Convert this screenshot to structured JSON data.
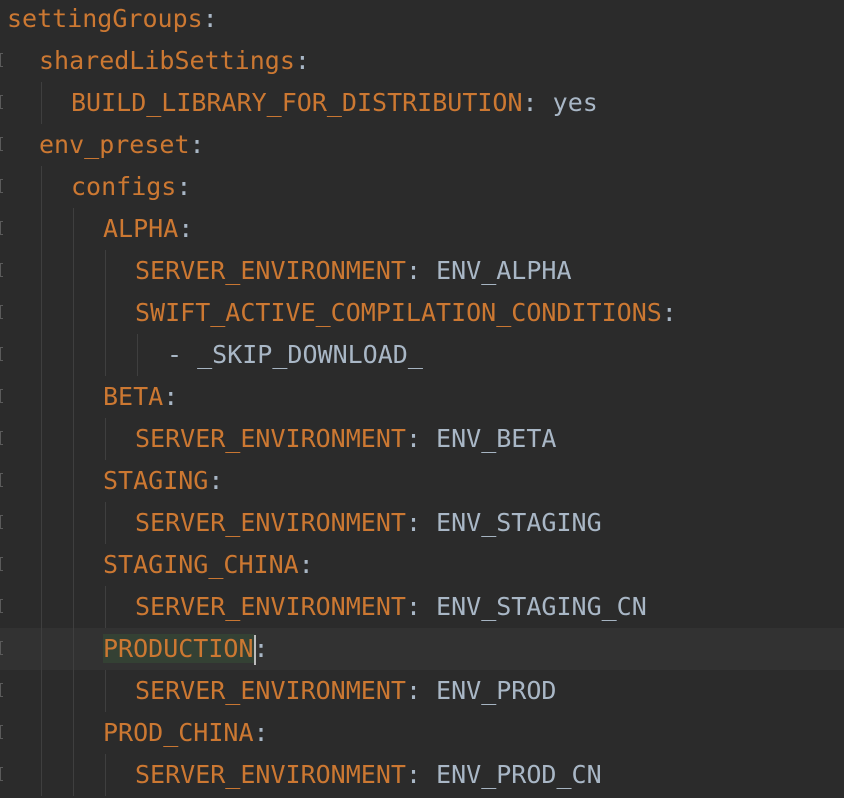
{
  "editor": {
    "lines": [
      {
        "indent": 0,
        "key": "settingGroups",
        "sep": ":",
        "value": ""
      },
      {
        "indent": 1,
        "key": "sharedLibSettings",
        "sep": ":",
        "value": ""
      },
      {
        "indent": 2,
        "key": "BUILD_LIBRARY_FOR_DISTRIBUTION",
        "sep": ":",
        "value": " yes"
      },
      {
        "indent": 1,
        "key": "env_preset",
        "sep": ":",
        "value": ""
      },
      {
        "indent": 2,
        "key": "configs",
        "sep": ":",
        "value": ""
      },
      {
        "indent": 3,
        "key": "ALPHA",
        "sep": ":",
        "value": ""
      },
      {
        "indent": 4,
        "key": "SERVER_ENVIRONMENT",
        "sep": ":",
        "value": " ENV_ALPHA"
      },
      {
        "indent": 4,
        "key": "SWIFT_ACTIVE_COMPILATION_CONDITIONS",
        "sep": ":",
        "value": ""
      },
      {
        "indent": 5,
        "key": "",
        "sep": "",
        "value": "- _SKIP_DOWNLOAD_"
      },
      {
        "indent": 3,
        "key": "BETA",
        "sep": ":",
        "value": ""
      },
      {
        "indent": 4,
        "key": "SERVER_ENVIRONMENT",
        "sep": ":",
        "value": " ENV_BETA"
      },
      {
        "indent": 3,
        "key": "STAGING",
        "sep": ":",
        "value": ""
      },
      {
        "indent": 4,
        "key": "SERVER_ENVIRONMENT",
        "sep": ":",
        "value": " ENV_STAGING"
      },
      {
        "indent": 3,
        "key": "STAGING_CHINA",
        "sep": ":",
        "value": ""
      },
      {
        "indent": 4,
        "key": "SERVER_ENVIRONMENT",
        "sep": ":",
        "value": " ENV_STAGING_CN"
      },
      {
        "indent": 3,
        "key": "PRODUCTION",
        "sep": ":",
        "value": "",
        "current": true
      },
      {
        "indent": 4,
        "key": "SERVER_ENVIRONMENT",
        "sep": ":",
        "value": " ENV_PROD"
      },
      {
        "indent": 3,
        "key": "PROD_CHINA",
        "sep": ":",
        "value": ""
      },
      {
        "indent": 4,
        "key": "SERVER_ENVIRONMENT",
        "sep": ":",
        "value": " ENV_PROD_CN"
      }
    ]
  },
  "colors": {
    "background": "#2b2b2b",
    "current_line": "#323232",
    "key": "#cc7832",
    "value": "#a9b7c6",
    "identifier_highlight": "#344134"
  }
}
